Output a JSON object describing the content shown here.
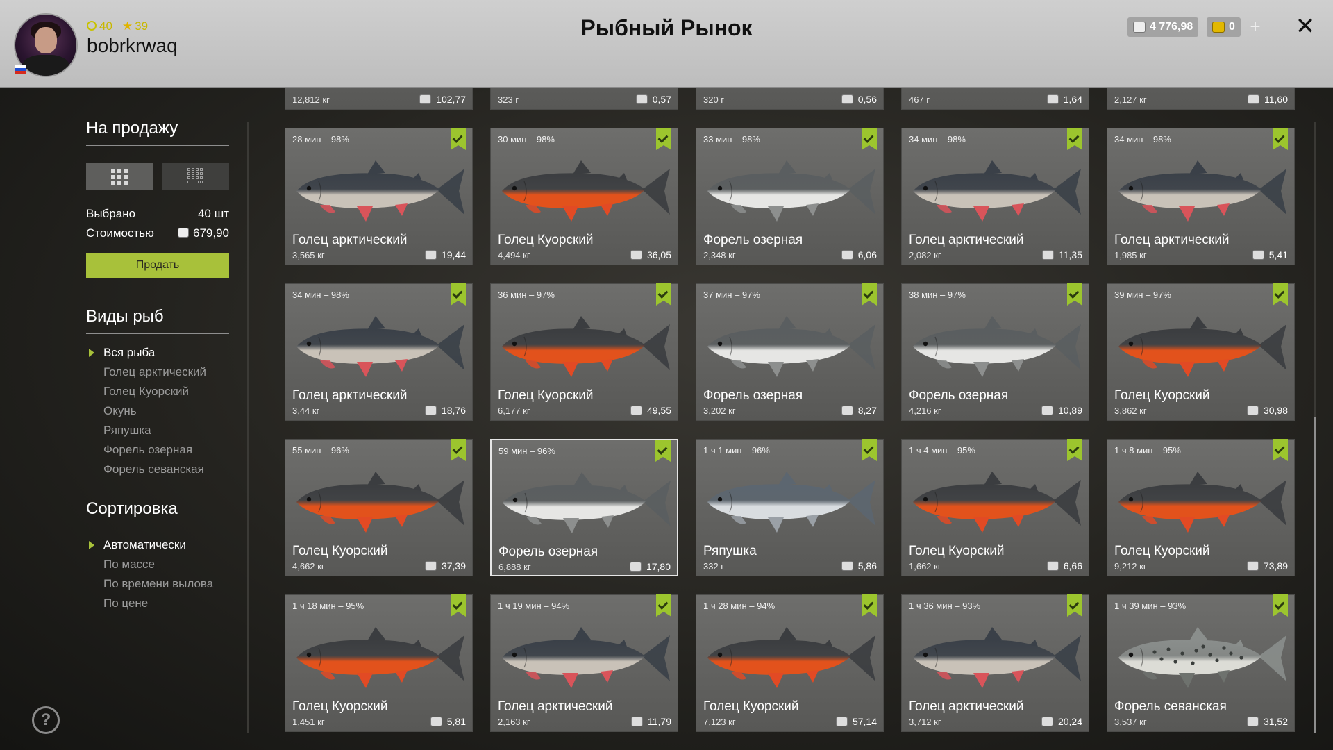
{
  "header": {
    "title": "Рыбный Рынок",
    "username": "bobrkrwaq",
    "level": "40",
    "stars": "39",
    "silver": "4 776,98",
    "gold": "0",
    "plus": "+",
    "close": "✕"
  },
  "sidebar": {
    "sale_title": "На продажу",
    "selected_label": "Выбрано",
    "selected_value": "40 шт",
    "cost_label": "Стоимостью",
    "cost_value": "679,90",
    "sell_button": "Продать",
    "species_title": "Виды рыб",
    "species": [
      "Вся рыба",
      "Голец арктический",
      "Голец Куорский",
      "Окунь",
      "Ряпушка",
      "Форель озерная",
      "Форель севанская"
    ],
    "sort_title": "Сортировка",
    "sort": [
      "Автоматически",
      "По массе",
      "По времени вылова",
      "По цене"
    ],
    "help": "?"
  },
  "top_partial": [
    {
      "weight": "12,812 кг",
      "price": "102,77"
    },
    {
      "weight": "323 г",
      "price": "0,57"
    },
    {
      "weight": "320 г",
      "price": "0,56"
    },
    {
      "weight": "467 г",
      "price": "1,64"
    },
    {
      "weight": "2,127 кг",
      "price": "11,60"
    }
  ],
  "cards": [
    {
      "meta": "28 мин – 98%",
      "name": "Голец арктический",
      "weight": "3,565 кг",
      "price": "19,44",
      "kind": "arctic"
    },
    {
      "meta": "30 мин – 98%",
      "name": "Голец Куорский",
      "weight": "4,494 кг",
      "price": "36,05",
      "kind": "kuor"
    },
    {
      "meta": "33 мин – 98%",
      "name": "Форель озерная",
      "weight": "2,348 кг",
      "price": "6,06",
      "kind": "trout"
    },
    {
      "meta": "34 мин – 98%",
      "name": "Голец арктический",
      "weight": "2,082 кг",
      "price": "11,35",
      "kind": "arctic"
    },
    {
      "meta": "34 мин – 98%",
      "name": "Голец арктический",
      "weight": "1,985 кг",
      "price": "5,41",
      "kind": "arctic"
    },
    {
      "meta": "34 мин – 98%",
      "name": "Голец арктический",
      "weight": "3,44 кг",
      "price": "18,76",
      "kind": "arctic"
    },
    {
      "meta": "36 мин – 97%",
      "name": "Голец Куорский",
      "weight": "6,177 кг",
      "price": "49,55",
      "kind": "kuor"
    },
    {
      "meta": "37 мин – 97%",
      "name": "Форель озерная",
      "weight": "3,202 кг",
      "price": "8,27",
      "kind": "trout"
    },
    {
      "meta": "38 мин – 97%",
      "name": "Форель озерная",
      "weight": "4,216 кг",
      "price": "10,89",
      "kind": "trout"
    },
    {
      "meta": "39 мин – 97%",
      "name": "Голец Куорский",
      "weight": "3,862 кг",
      "price": "30,98",
      "kind": "kuor"
    },
    {
      "meta": "55 мин – 96%",
      "name": "Голец Куорский",
      "weight": "4,662 кг",
      "price": "37,39",
      "kind": "kuor"
    },
    {
      "meta": "59 мин – 96%",
      "name": "Форель озерная",
      "weight": "6,888 кг",
      "price": "17,80",
      "kind": "trout"
    },
    {
      "meta": "1 ч 1 мин – 96%",
      "name": "Ряпушка",
      "weight": "332 г",
      "price": "5,86",
      "kind": "vendace"
    },
    {
      "meta": "1 ч 4 мин – 95%",
      "name": "Голец Куорский",
      "weight": "1,662 кг",
      "price": "6,66",
      "kind": "kuor"
    },
    {
      "meta": "1 ч 8 мин – 95%",
      "name": "Голец Куорский",
      "weight": "9,212 кг",
      "price": "73,89",
      "kind": "kuor"
    },
    {
      "meta": "1 ч 18 мин – 95%",
      "name": "Голец Куорский",
      "weight": "1,451 кг",
      "price": "5,81",
      "kind": "kuor"
    },
    {
      "meta": "1 ч 19 мин – 94%",
      "name": "Голец арктический",
      "weight": "2,163 кг",
      "price": "11,79",
      "kind": "arctic"
    },
    {
      "meta": "1 ч 28 мин – 94%",
      "name": "Голец Куорский",
      "weight": "7,123 кг",
      "price": "57,14",
      "kind": "kuor"
    },
    {
      "meta": "1 ч 36 мин – 93%",
      "name": "Голец арктический",
      "weight": "3,712 кг",
      "price": "20,24",
      "kind": "arctic"
    },
    {
      "meta": "1 ч 39 мин – 93%",
      "name": "Форель севанская",
      "weight": "3,537 кг",
      "price": "31,52",
      "kind": "sevan"
    }
  ],
  "highlighted_card": 11,
  "fish_colors": {
    "arctic": {
      "back": "#3a4048",
      "belly": "#c9c2b8",
      "fin": "#d9545a"
    },
    "kuor": {
      "back": "#3b3d40",
      "belly": "#e2521c",
      "fin": "#e24a24"
    },
    "trout": {
      "back": "#5a5e60",
      "belly": "#e6e6e4",
      "fin": "#8d8f8e"
    },
    "vendace": {
      "back": "#5c6670",
      "belly": "#d9dde0",
      "fin": "#9aa0a6"
    },
    "sevan": {
      "back": "#8a8e8c",
      "belly": "#dcdcd6",
      "fin": "#6e726e"
    }
  },
  "accent": "#a8c13a"
}
